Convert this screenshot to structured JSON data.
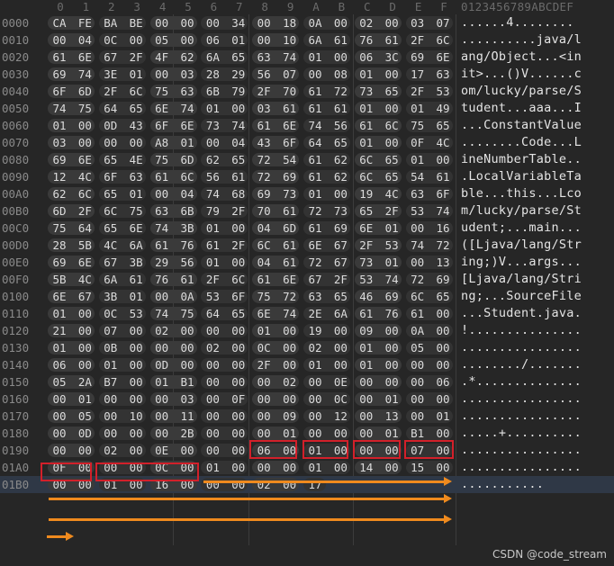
{
  "column_headers": [
    "0",
    "1",
    "2",
    "3",
    "4",
    "5",
    "6",
    "7",
    "8",
    "9",
    "A",
    "B",
    "C",
    "D",
    "E",
    "F"
  ],
  "ascii_header": "0123456789ABCDEF",
  "rows": [
    {
      "offset": "0000",
      "bytes": [
        "CA",
        "FE",
        "BA",
        "BE",
        "00",
        "00",
        "00",
        "34",
        "00",
        "18",
        "0A",
        "00",
        "02",
        "00",
        "03",
        "07"
      ],
      "ascii": "......4........"
    },
    {
      "offset": "0010",
      "bytes": [
        "00",
        "04",
        "0C",
        "00",
        "05",
        "00",
        "06",
        "01",
        "00",
        "10",
        "6A",
        "61",
        "76",
        "61",
        "2F",
        "6C"
      ],
      "ascii": "..........java/l"
    },
    {
      "offset": "0020",
      "bytes": [
        "61",
        "6E",
        "67",
        "2F",
        "4F",
        "62",
        "6A",
        "65",
        "63",
        "74",
        "01",
        "00",
        "06",
        "3C",
        "69",
        "6E"
      ],
      "ascii": "ang/Object...<in"
    },
    {
      "offset": "0030",
      "bytes": [
        "69",
        "74",
        "3E",
        "01",
        "00",
        "03",
        "28",
        "29",
        "56",
        "07",
        "00",
        "08",
        "01",
        "00",
        "17",
        "63"
      ],
      "ascii": "it>...()V......c"
    },
    {
      "offset": "0040",
      "bytes": [
        "6F",
        "6D",
        "2F",
        "6C",
        "75",
        "63",
        "6B",
        "79",
        "2F",
        "70",
        "61",
        "72",
        "73",
        "65",
        "2F",
        "53"
      ],
      "ascii": "om/lucky/parse/S"
    },
    {
      "offset": "0050",
      "bytes": [
        "74",
        "75",
        "64",
        "65",
        "6E",
        "74",
        "01",
        "00",
        "03",
        "61",
        "61",
        "61",
        "01",
        "00",
        "01",
        "49"
      ],
      "ascii": "tudent...aaa...I"
    },
    {
      "offset": "0060",
      "bytes": [
        "01",
        "00",
        "0D",
        "43",
        "6F",
        "6E",
        "73",
        "74",
        "61",
        "6E",
        "74",
        "56",
        "61",
        "6C",
        "75",
        "65"
      ],
      "ascii": "...ConstantValue"
    },
    {
      "offset": "0070",
      "bytes": [
        "03",
        "00",
        "00",
        "00",
        "A8",
        "01",
        "00",
        "04",
        "43",
        "6F",
        "64",
        "65",
        "01",
        "00",
        "0F",
        "4C"
      ],
      "ascii": "........Code...L"
    },
    {
      "offset": "0080",
      "bytes": [
        "69",
        "6E",
        "65",
        "4E",
        "75",
        "6D",
        "62",
        "65",
        "72",
        "54",
        "61",
        "62",
        "6C",
        "65",
        "01",
        "00"
      ],
      "ascii": "ineNumberTable.."
    },
    {
      "offset": "0090",
      "bytes": [
        "12",
        "4C",
        "6F",
        "63",
        "61",
        "6C",
        "56",
        "61",
        "72",
        "69",
        "61",
        "62",
        "6C",
        "65",
        "54",
        "61"
      ],
      "ascii": ".LocalVariableTa"
    },
    {
      "offset": "00A0",
      "bytes": [
        "62",
        "6C",
        "65",
        "01",
        "00",
        "04",
        "74",
        "68",
        "69",
        "73",
        "01",
        "00",
        "19",
        "4C",
        "63",
        "6F"
      ],
      "ascii": "ble...this...Lco"
    },
    {
      "offset": "00B0",
      "bytes": [
        "6D",
        "2F",
        "6C",
        "75",
        "63",
        "6B",
        "79",
        "2F",
        "70",
        "61",
        "72",
        "73",
        "65",
        "2F",
        "53",
        "74"
      ],
      "ascii": "m/lucky/parse/St"
    },
    {
      "offset": "00C0",
      "bytes": [
        "75",
        "64",
        "65",
        "6E",
        "74",
        "3B",
        "01",
        "00",
        "04",
        "6D",
        "61",
        "69",
        "6E",
        "01",
        "00",
        "16"
      ],
      "ascii": "udent;...main..."
    },
    {
      "offset": "00D0",
      "bytes": [
        "28",
        "5B",
        "4C",
        "6A",
        "61",
        "76",
        "61",
        "2F",
        "6C",
        "61",
        "6E",
        "67",
        "2F",
        "53",
        "74",
        "72"
      ],
      "ascii": "([Ljava/lang/Str"
    },
    {
      "offset": "00E0",
      "bytes": [
        "69",
        "6E",
        "67",
        "3B",
        "29",
        "56",
        "01",
        "00",
        "04",
        "61",
        "72",
        "67",
        "73",
        "01",
        "00",
        "13"
      ],
      "ascii": "ing;)V...args..."
    },
    {
      "offset": "00F0",
      "bytes": [
        "5B",
        "4C",
        "6A",
        "61",
        "76",
        "61",
        "2F",
        "6C",
        "61",
        "6E",
        "67",
        "2F",
        "53",
        "74",
        "72",
        "69"
      ],
      "ascii": "[Ljava/lang/Stri"
    },
    {
      "offset": "0100",
      "bytes": [
        "6E",
        "67",
        "3B",
        "01",
        "00",
        "0A",
        "53",
        "6F",
        "75",
        "72",
        "63",
        "65",
        "46",
        "69",
        "6C",
        "65"
      ],
      "ascii": "ng;...SourceFile"
    },
    {
      "offset": "0110",
      "bytes": [
        "01",
        "00",
        "0C",
        "53",
        "74",
        "75",
        "64",
        "65",
        "6E",
        "74",
        "2E",
        "6A",
        "61",
        "76",
        "61",
        "00"
      ],
      "ascii": "...Student.java."
    },
    {
      "offset": "0120",
      "bytes": [
        "21",
        "00",
        "07",
        "00",
        "02",
        "00",
        "00",
        "00",
        "01",
        "00",
        "19",
        "00",
        "09",
        "00",
        "0A",
        "00"
      ],
      "ascii": "!..............."
    },
    {
      "offset": "0130",
      "bytes": [
        "01",
        "00",
        "0B",
        "00",
        "00",
        "00",
        "02",
        "00",
        "0C",
        "00",
        "02",
        "00",
        "01",
        "00",
        "05",
        "00"
      ],
      "ascii": "................"
    },
    {
      "offset": "0140",
      "bytes": [
        "06",
        "00",
        "01",
        "00",
        "0D",
        "00",
        "00",
        "00",
        "2F",
        "00",
        "01",
        "00",
        "01",
        "00",
        "00",
        "00"
      ],
      "ascii": "......../......."
    },
    {
      "offset": "0150",
      "bytes": [
        "05",
        "2A",
        "B7",
        "00",
        "01",
        "B1",
        "00",
        "00",
        "00",
        "02",
        "00",
        "0E",
        "00",
        "00",
        "00",
        "06"
      ],
      "ascii": ".*.............."
    },
    {
      "offset": "0160",
      "bytes": [
        "00",
        "01",
        "00",
        "00",
        "00",
        "03",
        "00",
        "0F",
        "00",
        "00",
        "00",
        "0C",
        "00",
        "01",
        "00",
        "00"
      ],
      "ascii": "................"
    },
    {
      "offset": "0170",
      "bytes": [
        "00",
        "05",
        "00",
        "10",
        "00",
        "11",
        "00",
        "00",
        "00",
        "09",
        "00",
        "12",
        "00",
        "13",
        "00",
        "01"
      ],
      "ascii": "................"
    },
    {
      "offset": "0180",
      "bytes": [
        "00",
        "0D",
        "00",
        "00",
        "00",
        "2B",
        "00",
        "00",
        "00",
        "01",
        "00",
        "00",
        "00",
        "01",
        "B1",
        "00"
      ],
      "ascii": ".....+.........."
    },
    {
      "offset": "0190",
      "bytes": [
        "00",
        "00",
        "02",
        "00",
        "0E",
        "00",
        "00",
        "00",
        "06",
        "00",
        "01",
        "00",
        "00",
        "00",
        "07",
        "00"
      ],
      "ascii": "................"
    },
    {
      "offset": "01A0",
      "bytes": [
        "0F",
        "00",
        "00",
        "00",
        "0C",
        "00",
        "01",
        "00",
        "00",
        "00",
        "01",
        "00",
        "14",
        "00",
        "15",
        "00"
      ],
      "ascii": "................"
    },
    {
      "offset": "01B0",
      "bytes": [
        "00",
        "00",
        "01",
        "00",
        "16",
        "00",
        "00",
        "00",
        "02",
        "00",
        "17"
      ],
      "ascii": "..........."
    }
  ],
  "watermark": "CSDN @code_stream",
  "colors": {
    "background": "#262626",
    "highlight_box": "#d2202a",
    "arrow": "#ef8a1e",
    "selected_row": "#2f3846"
  }
}
